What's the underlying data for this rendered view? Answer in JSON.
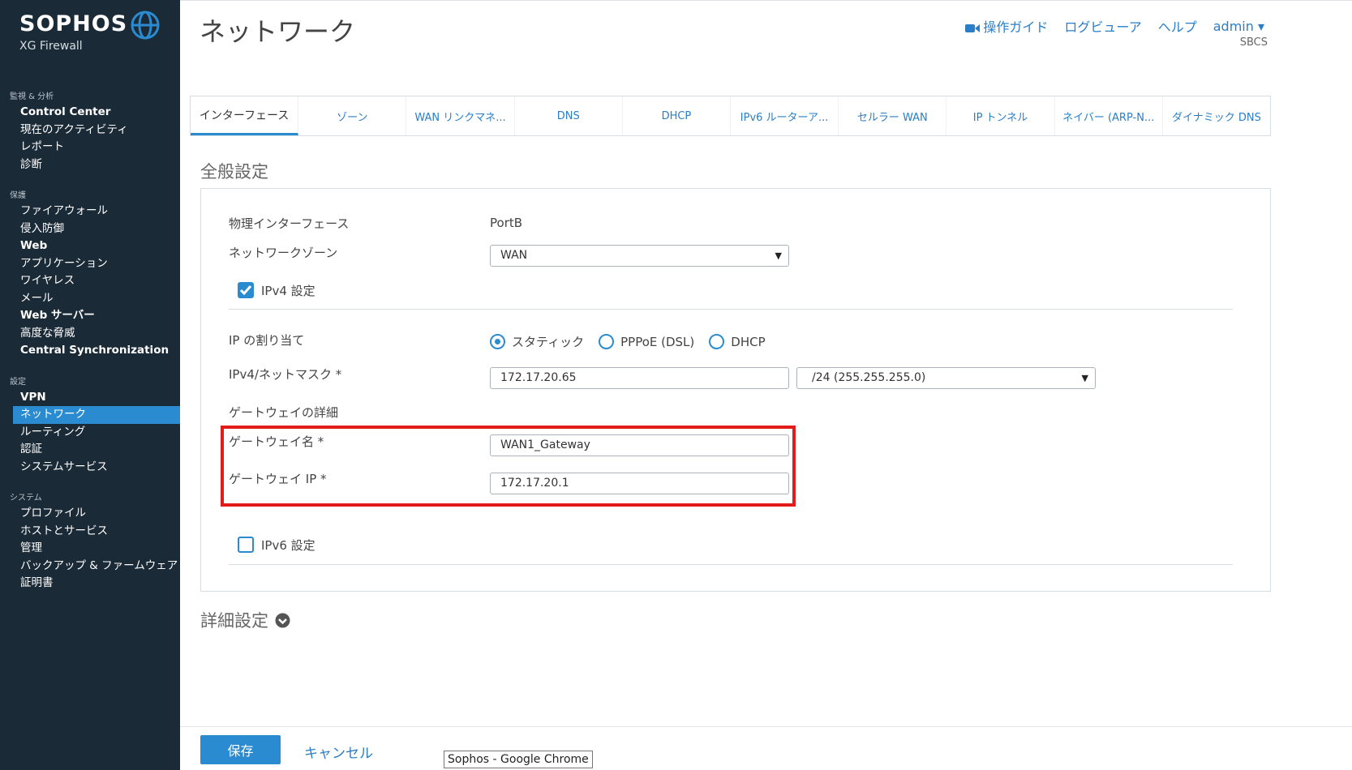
{
  "brand": {
    "name": "SOPHOS",
    "product": "XG Firewall"
  },
  "nav": {
    "sections": [
      {
        "title": "監視 & 分析",
        "items": [
          {
            "label": "Control Center",
            "bold": true
          },
          {
            "label": "現在のアクティビティ"
          },
          {
            "label": "レポート"
          },
          {
            "label": "診断"
          }
        ]
      },
      {
        "title": "保護",
        "items": [
          {
            "label": "ファイアウォール"
          },
          {
            "label": "侵入防御"
          },
          {
            "label": "Web",
            "bold": true
          },
          {
            "label": "アプリケーション"
          },
          {
            "label": "ワイヤレス"
          },
          {
            "label": "メール"
          },
          {
            "label": "Web サーバー",
            "bold": true
          },
          {
            "label": "高度な脅威"
          },
          {
            "label": "Central Synchronization",
            "bold": true
          }
        ]
      },
      {
        "title": "設定",
        "items": [
          {
            "label": "VPN",
            "bold": true
          },
          {
            "label": "ネットワーク",
            "active": true
          },
          {
            "label": "ルーティング"
          },
          {
            "label": "認証"
          },
          {
            "label": "システムサービス"
          }
        ]
      },
      {
        "title": "システム",
        "items": [
          {
            "label": "プロファイル"
          },
          {
            "label": "ホストとサービス"
          },
          {
            "label": "管理"
          },
          {
            "label": "バックアップ & ファームウェア"
          },
          {
            "label": "証明書"
          }
        ]
      }
    ]
  },
  "header": {
    "title": "ネットワーク",
    "guide": "操作ガイド",
    "log_viewer": "ログビューア",
    "help": "ヘルプ",
    "user": "admin ▾",
    "tenant": "SBCS"
  },
  "tabs": [
    {
      "label": "インターフェース",
      "active": true
    },
    {
      "label": "ゾーン"
    },
    {
      "label": "WAN リンクマネ..."
    },
    {
      "label": "DNS"
    },
    {
      "label": "DHCP"
    },
    {
      "label": "IPv6 ルーターア..."
    },
    {
      "label": "セルラー WAN"
    },
    {
      "label": "IP トンネル"
    },
    {
      "label": "ネイバー (ARP-N..."
    },
    {
      "label": "ダイナミック DNS"
    }
  ],
  "general": {
    "section_title": "全般設定",
    "physical_label": "物理インターフェース",
    "physical_value": "PortB",
    "zone_label": "ネットワークゾーン",
    "zone_value": "WAN",
    "ipv4_label": "IPv4 設定",
    "ipv4_checked": true,
    "assign_label": "IP の割り当て",
    "assign_options": [
      "スタティック",
      "PPPoE (DSL)",
      "DHCP"
    ],
    "assign_selected": "スタティック",
    "ip_label": "IPv4/ネットマスク *",
    "ip_value": "172.17.20.65",
    "netmask_value": "/24 (255.255.255.0)",
    "gw_details_label": "ゲートウェイの詳細",
    "gw_name_label": "ゲートウェイ名 *",
    "gw_name_value": "WAN1_Gateway",
    "gw_ip_label": "ゲートウェイ IP *",
    "gw_ip_value": "172.17.20.1",
    "ipv6_label": "IPv6 設定",
    "ipv6_checked": false
  },
  "advanced": {
    "title": "詳細設定"
  },
  "footer": {
    "save": "保存",
    "cancel": "キャンセル"
  },
  "tooltip": "Sophos - Google Chrome",
  "colors": {
    "sidebar": "#1b2a37",
    "accent": "#2a8bd0",
    "link": "#2a7ec7",
    "highlight": "#e31b1b"
  }
}
